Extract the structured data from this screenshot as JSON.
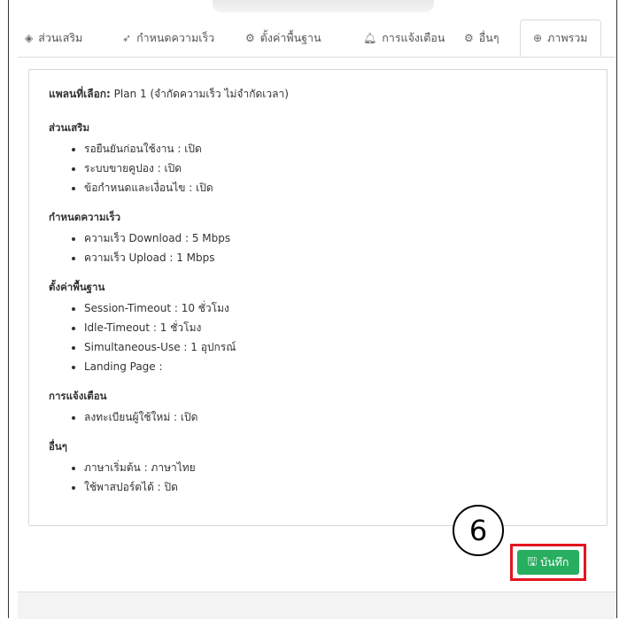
{
  "tabs": [
    {
      "label": "ส่วนเสริม",
      "icon": "layers-icon",
      "active": false
    },
    {
      "label": "กำหนดความเร็ว",
      "icon": "rocket-icon",
      "active": false
    },
    {
      "label": "ตั้งค่าพื้นฐาน",
      "icon": "gear-icon",
      "active": false
    },
    {
      "label": "การแจ้งเตือน",
      "icon": "bell-icon",
      "active": false
    },
    {
      "label": "อื่นๆ",
      "icon": "cogs-icon",
      "active": false
    },
    {
      "label": "ภาพรวม",
      "icon": "globe-icon",
      "active": true
    }
  ],
  "summary": {
    "plan_label": "แพลนที่เลือก:",
    "plan_value": "Plan 1 (จำกัดความเร็ว ไม่จำกัดเวลา)",
    "sections": [
      {
        "title": "ส่วนเสริม",
        "items": [
          "รอยืนยันก่อนใช้งาน : เปิด",
          "ระบบขายคูปอง : เปิด",
          "ข้อกำหนดและเงื่อนไข : เปิด"
        ]
      },
      {
        "title": "กำหนดความเร็ว",
        "items": [
          "ความเร็ว Download : 5 Mbps",
          "ความเร็ว Upload : 1 Mbps"
        ]
      },
      {
        "title": "ตั้งค่าพื้นฐาน",
        "items": [
          "Session-Timeout : 10 ชั่วโมง",
          "Idle-Timeout : 1 ชั่วโมง",
          "Simultaneous-Use : 1 อุปกรณ์",
          "Landing Page :"
        ]
      },
      {
        "title": "การแจ้งเตือน",
        "items": [
          "ลงทะเบียนผู้ใช้ใหม่ : เปิด"
        ]
      },
      {
        "title": "อื่นๆ",
        "items": [
          "ภาษาเริ่มต้น : ภาษาไทย",
          "ใช้พาสปอร์ตได้ : ปิด"
        ]
      }
    ]
  },
  "save_button": {
    "label": "บันทึก",
    "icon": "floppy-disk-icon",
    "color": "#27ae60"
  },
  "annotation": {
    "step_number": "6",
    "highlight_color": "#e5141d"
  }
}
